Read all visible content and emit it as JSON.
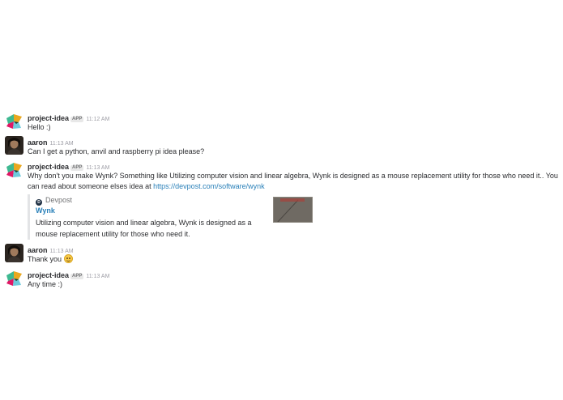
{
  "messages": [
    {
      "author": "project-idea",
      "badge": "APP",
      "time": "11:12 AM",
      "text": "Hello :)"
    },
    {
      "author": "aaron",
      "time": "11:13 AM",
      "text": "Can I get a python, anvil and raspberry pi idea please?"
    },
    {
      "author": "project-idea",
      "badge": "APP",
      "time": "11:13 AM",
      "text_line1": "Why don't you make Wynk? Something like Utilizing computer vision and linear algebra, Wynk is designed as a mouse replacement utility for those who need it.. You",
      "text_line2": "can read about someone elses idea at ",
      "link": "https://devpost.com/software/wynk",
      "attachment": {
        "source": "Devpost",
        "source_icon": "devpost-icon",
        "title": "Wynk",
        "description": "Utilizing computer vision and linear algebra, Wynk is designed as a mouse replacement utility for those who need it."
      }
    },
    {
      "author": "aaron",
      "time": "11:13 AM",
      "text": "Thank you ",
      "emoji": "slightly-smiling-face"
    },
    {
      "author": "project-idea",
      "badge": "APP",
      "time": "11:13 AM",
      "text": "Any time :)"
    }
  ],
  "colors": {
    "link": "#2a80b9",
    "author": "#2c2d30",
    "timestamp": "#9e9ea6",
    "attachment_border": "#e3e4e6"
  }
}
